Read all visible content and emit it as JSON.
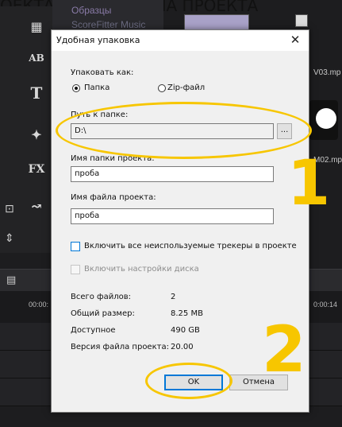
{
  "caption": "ОЕКТА  И  ИМЯ ФАЙЛА ПРОЕКТА",
  "background_app": {
    "library_items": [
      "Образцы",
      "ScoreFitter Music"
    ],
    "thumb_labels": [
      "V03.mp",
      "M02.mp"
    ],
    "ruler_labels": [
      "00:00:",
      "0:00:14"
    ]
  },
  "dialog": {
    "title": "Удобная упаковка",
    "pack_as_label": "Упаковать как:",
    "radio_folder": "Папка",
    "radio_zip": "Zip-файл",
    "folder_path_label": "Путь к папке:",
    "folder_path_value": "D:\\",
    "browse_label": "...",
    "project_folder_label": "Имя папки проекта:",
    "project_folder_value": "проба",
    "project_file_label": "Имя файла проекта:",
    "project_file_value": "проба",
    "include_trackers_label": "Включить все неиспользуемые трекеры в проекте",
    "disk_settings_label": "Включить настройки диска",
    "stats": [
      {
        "label": "Всего файлов:",
        "value": "2"
      },
      {
        "label": "Общий размер:",
        "value": "8.25 MB"
      },
      {
        "label": "Доступное",
        "value": "490 GB"
      },
      {
        "label": "Версия файла проекта:",
        "value": "20.00"
      }
    ],
    "ok_label": "OK",
    "cancel_label": "Отмена"
  },
  "annotations": {
    "step1": "1",
    "step2": "2",
    "accent_color": "#f7c600"
  }
}
